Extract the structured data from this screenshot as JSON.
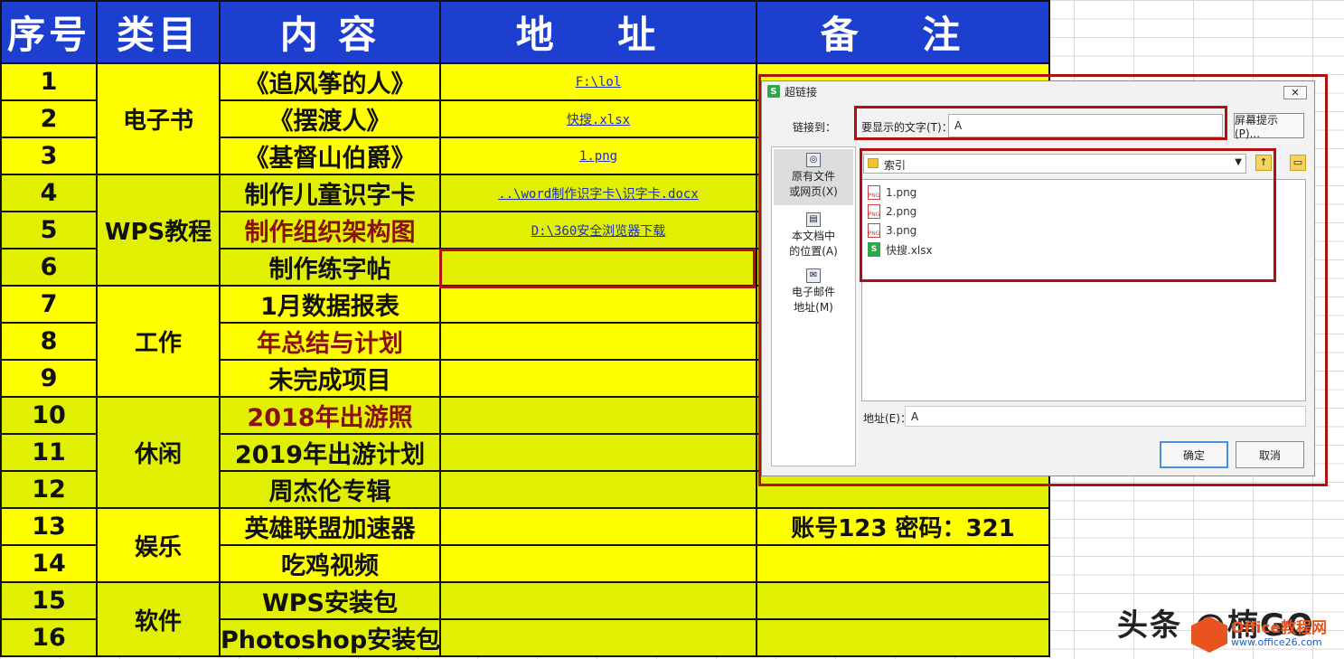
{
  "headers": {
    "seq": "序号",
    "category": "类目",
    "content": "内 容",
    "address": "地 址",
    "note": "备 注"
  },
  "rows": [
    {
      "seq": "1",
      "content": "《追风筝的人》",
      "address": "F:\\lol",
      "note": "",
      "content_style": "normal"
    },
    {
      "seq": "2",
      "content": "《摆渡人》",
      "address": "快搜.xlsx",
      "note": "",
      "content_style": "normal"
    },
    {
      "seq": "3",
      "content": "《基督山伯爵》",
      "address": "1.png",
      "note": "",
      "content_style": "normal"
    },
    {
      "seq": "4",
      "content": "制作儿童识字卡",
      "address": "..\\word制作识字卡\\识字卡.docx",
      "note": "",
      "content_style": "normal"
    },
    {
      "seq": "5",
      "content": "制作组织架构图",
      "address": "D:\\360安全浏览器下载",
      "note": "",
      "content_style": "red"
    },
    {
      "seq": "6",
      "content": "制作练字帖",
      "address": "",
      "note": "",
      "content_style": "normal"
    },
    {
      "seq": "7",
      "content": "1月数据报表",
      "address": "",
      "note": "",
      "content_style": "normal"
    },
    {
      "seq": "8",
      "content": "年总结与计划",
      "address": "",
      "note": "",
      "content_style": "red"
    },
    {
      "seq": "9",
      "content": "未完成项目",
      "address": "",
      "note": "",
      "content_style": "normal"
    },
    {
      "seq": "10",
      "content": "2018年出游照",
      "address": "",
      "note": "",
      "content_style": "red"
    },
    {
      "seq": "11",
      "content": "2019年出游计划",
      "address": "",
      "note": "",
      "content_style": "normal"
    },
    {
      "seq": "12",
      "content": "周杰伦专辑",
      "address": "",
      "note": "",
      "content_style": "normal"
    },
    {
      "seq": "13",
      "content": "英雄联盟加速器",
      "address": "",
      "note": "账号123  密码：321",
      "content_style": "normal"
    },
    {
      "seq": "14",
      "content": "吃鸡视频",
      "address": "",
      "note": "",
      "content_style": "normal"
    },
    {
      "seq": "15",
      "content": "WPS安装包",
      "address": "",
      "note": "",
      "content_style": "normal"
    },
    {
      "seq": "16",
      "content": "Photoshop安装包",
      "address": "",
      "note": "",
      "content_style": "normal"
    }
  ],
  "categories": {
    "c1": "电子书",
    "c2": "WPS教程",
    "c3": "工作",
    "c4": "休闲",
    "c5": "娱乐",
    "c6": "软件"
  },
  "dialog": {
    "title": "超链接",
    "app_icon": "S",
    "close": "✕",
    "link_to_label": "链接到：",
    "display_text_label": "要显示的文字(T)：",
    "display_text_value": "A",
    "screen_tip_button": "屏幕提示(P)...",
    "nav": [
      {
        "label": "原有文件\n或网页(X)",
        "selected": true
      },
      {
        "label": "本文档中\n的位置(A)",
        "selected": false
      },
      {
        "label": "电子邮件\n地址(M)",
        "selected": false
      }
    ],
    "folder": "索引",
    "files": [
      "1.png",
      "2.png",
      "3.png",
      "快搜.xlsx"
    ],
    "address_label": "地址(E)：",
    "address_value": "A",
    "ok": "确定",
    "cancel": "取消"
  },
  "watermark": {
    "text": "头条 @楠GO",
    "logo_line1": "Office教程网",
    "logo_line2": "www.office26.com"
  },
  "colors": {
    "header_bg": "#1c3fd0",
    "cell_yellow": "#ffff00",
    "cell_green": "#e0f000",
    "highlight_red": "#b01010"
  }
}
